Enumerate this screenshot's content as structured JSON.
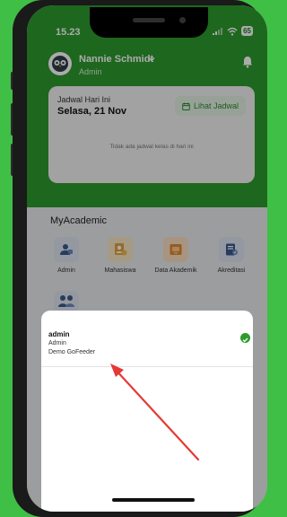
{
  "status_bar": {
    "time": "15.23",
    "battery": "65"
  },
  "header": {
    "user_name": "Nannie Schmidt",
    "user_role": "Admin"
  },
  "schedule_card": {
    "label": "Jadwal Hari Ini",
    "date": "Selasa, 21 Nov",
    "button_label": "Lihat Jadwal",
    "empty_message": "Tidak ada jadwal kelas di hari ini"
  },
  "my_academic": {
    "title": "MyAcademic",
    "items": [
      {
        "label": "Admin",
        "icon": "admin-icon"
      },
      {
        "label": "Mahasiswa",
        "icon": "student-icon"
      },
      {
        "label": "Data Akademik",
        "icon": "academic-data-icon"
      },
      {
        "label": "Akreditasi",
        "icon": "accreditation-icon"
      }
    ]
  },
  "account_sheet": {
    "accounts": [
      {
        "name": "admin",
        "role": "Admin",
        "institution": "Demo GoFeeder",
        "selected": true
      }
    ]
  },
  "colors": {
    "brand_green": "#2e9a2e",
    "background_green": "#3fbf45",
    "annotation_arrow": "#e53935"
  }
}
